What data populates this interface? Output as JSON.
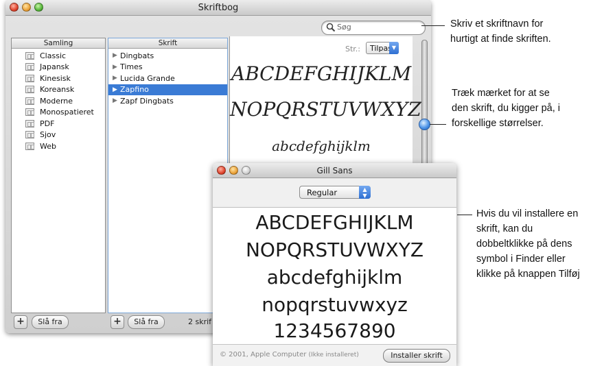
{
  "main_window": {
    "title": "Skriftbog",
    "search_placeholder": "Søg",
    "collection_header": "Samling",
    "collections": [
      "Classic",
      "Japansk",
      "Kinesisk",
      "Koreansk",
      "Moderne",
      "Monospatieret",
      "PDF",
      "Sjov",
      "Web"
    ],
    "font_header": "Skrift",
    "fonts": [
      {
        "label": "Dingbats",
        "selected": false
      },
      {
        "label": "Times",
        "selected": false
      },
      {
        "label": "Lucida Grande",
        "selected": false
      },
      {
        "label": "Zapfino",
        "selected": true
      },
      {
        "label": "Zapf Dingbats",
        "selected": false
      }
    ],
    "size_label": "Str.:",
    "size_value": "Tilpas",
    "preview_lines": [
      "ABCDEFGHIJKLM",
      "NOPQRSTUVWXYZ",
      "abcdefghijklm"
    ],
    "add_button": "+",
    "disable_collection_button": "Slå fra",
    "disable_font_button": "Slå fra",
    "font_count": "2 skrif"
  },
  "font_window": {
    "title": "Gill Sans",
    "style_value": "Regular",
    "preview_lines": [
      "ABCDEFGHIJKLM",
      "NOPQRSTUVWXYZ",
      "abcdefghijklm",
      "nopqrstuvwxyz",
      "1234567890"
    ],
    "copyright": "© 2001, Apple Computer",
    "install_status": "(Ikke installeret)",
    "install_button": "Installer skrift"
  },
  "callouts": {
    "search": [
      "Skriv et skriftnavn for",
      "hurtigt at finde skriften."
    ],
    "slider": [
      "Træk mærket for at se",
      "den skrift, du kigger på, i",
      "forskellige størrelser."
    ],
    "install": [
      "Hvis du vil installere en",
      "skrift, kan du",
      "dobbeltklikke på dens",
      "symbol i Finder eller",
      "klikke på knappen Tilføj"
    ]
  },
  "icons": {
    "search": "magnifier-icon",
    "collection": "book-icon",
    "expand": "disclosure-triangle-icon",
    "popup": "popup-arrows-icon"
  }
}
